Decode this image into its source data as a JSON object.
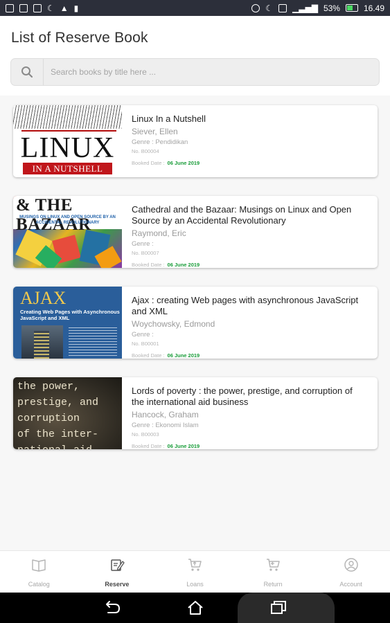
{
  "status_bar": {
    "battery": "53%",
    "time": "16.49"
  },
  "header": {
    "title": "List of Reserve Book"
  },
  "search": {
    "placeholder": "Search books by title here ..."
  },
  "books": [
    {
      "title": "Linux In a Nutshell",
      "author": "Siever, Ellen",
      "genre": "Genre : Pendidikan",
      "number": "No. B00004",
      "booked_label": "Booked Date :",
      "booked_date": "06 June 2019",
      "cover": {
        "line1": "LINUX",
        "line2": "IN A NUTSHELL"
      }
    },
    {
      "title": "Cathedral and the Bazaar: Musings on Linux and Open Source by an Accidental Revolutionary",
      "author": "Raymond, Eric",
      "genre": "Genre :",
      "number": "No. B00007",
      "booked_label": "Booked Date :",
      "booked_date": "06 June 2019",
      "cover": {
        "line1": "& THE BAZAAR",
        "line2": "MUSINGS ON LINUX AND OPEN SOURCE BY AN ACCIDENTAL REVOLUTIONARY"
      }
    },
    {
      "title": "Ajax : creating Web pages with asynchronous JavaScript and XML",
      "author": "Woychowsky, Edmond",
      "genre": "Genre :",
      "number": "No. B00001",
      "booked_label": "Booked Date :",
      "booked_date": "06 June 2019",
      "cover": {
        "line1": "AJAX",
        "line2": "Creating Web Pages with Asynchronous JavaScript and XML"
      }
    },
    {
      "title": "Lords of poverty : the power, prestige, and corruption of the international aid business",
      "author": "Hancock, Graham",
      "genre": "Genre : Ekonomi Islam",
      "number": "No. B00003",
      "booked_label": "Booked Date :",
      "booked_date": "06 June 2019",
      "cover": {
        "line1": "the power,\nprestige, and\ncorruption\nof the inter-\nnational aid"
      }
    }
  ],
  "bottom_nav": {
    "items": [
      {
        "label": "Catalog",
        "icon": "book-icon",
        "active": false
      },
      {
        "label": "Reserve",
        "icon": "edit-icon",
        "active": true
      },
      {
        "label": "Loans",
        "icon": "cart-out-icon",
        "active": false
      },
      {
        "label": "Return",
        "icon": "cart-in-icon",
        "active": false
      },
      {
        "label": "Account",
        "icon": "user-icon",
        "active": false
      }
    ]
  },
  "colors": {
    "accent_green": "#1a9d3a",
    "status_bar": "#2c2f3a"
  }
}
